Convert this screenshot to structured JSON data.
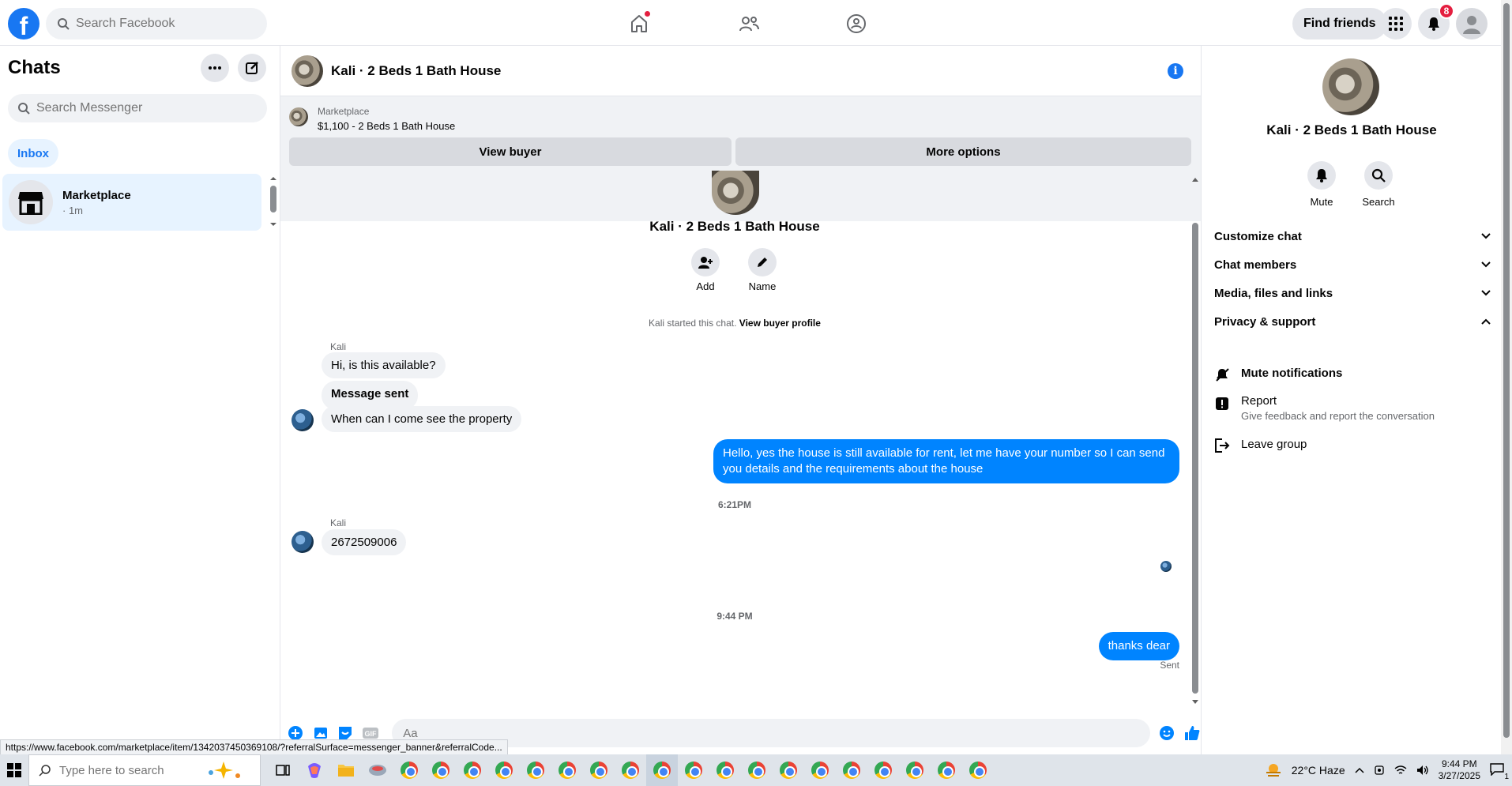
{
  "topbar": {
    "search_placeholder": "Search Facebook",
    "find_friends": "Find friends",
    "notifications_count": "8"
  },
  "sidebar": {
    "title": "Chats",
    "search_placeholder": "Search Messenger",
    "inbox_label": "Inbox",
    "conversation": {
      "name": "Marketplace",
      "meta": "· 1m"
    }
  },
  "chat": {
    "title": "Kali · 2 Beds 1 Bath House",
    "banner": {
      "label": "Marketplace",
      "listing": "$1,100 - 2 Beds 1 Bath House",
      "view_buyer": "View buyer",
      "more_options": "More options"
    },
    "intro": {
      "name": "Kali · 2 Beds 1 Bath House",
      "add_label": "Add",
      "name_label": "Name",
      "started_text": "Kali started this chat.",
      "started_link": "View buyer profile"
    },
    "messages": [
      {
        "sender": "Kali",
        "text": "Hi, is this available?"
      },
      {
        "text": "Message sent"
      },
      {
        "text": "When can I come see the property"
      },
      {
        "text": "Hello, yes the house is still available for rent, let me have your number so I can send you details and the requirements about the house"
      },
      {
        "time": "6:21PM"
      },
      {
        "sender": "Kali",
        "text": "2672509006"
      },
      {
        "time": "9:44 PM"
      },
      {
        "text": "thanks dear",
        "status": "Sent"
      }
    ],
    "composer_placeholder": "Aa",
    "gif_label": "GIF"
  },
  "status_url": "https://www.facebook.com/marketplace/item/1342037450369108/?referralSurface=messenger_banner&referralCode...",
  "right_panel": {
    "name": "Kali · 2 Beds 1 Bath House",
    "mute_label": "Mute",
    "search_label": "Search",
    "sections": [
      "Customize chat",
      "Chat members",
      "Media, files and links",
      "Privacy & support"
    ],
    "privacy_items": {
      "mute": "Mute notifications",
      "report": "Report",
      "report_sub": "Give feedback and report the conversation",
      "leave": "Leave group"
    }
  },
  "taskbar": {
    "search_placeholder": "Type here to search",
    "weather": "22°C  Haze",
    "time": "9:44 PM",
    "date": "3/27/2025",
    "notif_count": "1"
  },
  "colors": {
    "brand": "#1877f2",
    "outgoing_bubble": "#0084ff",
    "incoming_bubble": "#f0f2f5"
  }
}
